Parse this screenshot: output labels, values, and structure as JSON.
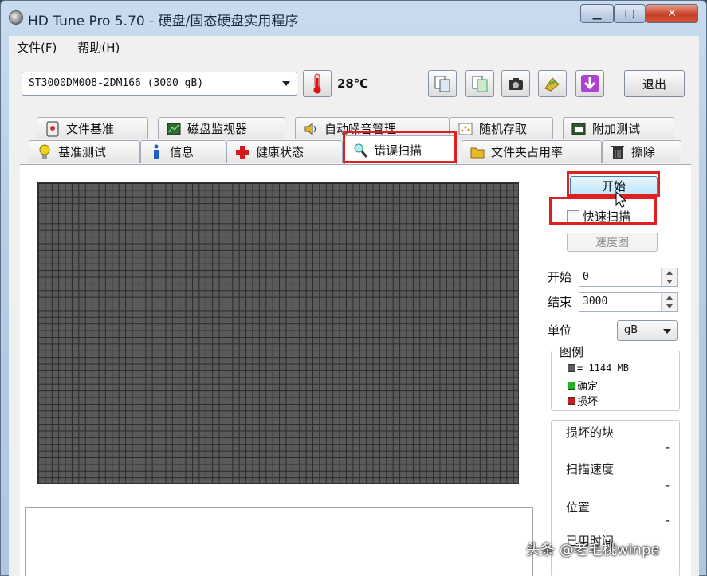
{
  "window": {
    "title": "HD Tune Pro 5.70 - 硬盘/固态硬盘实用程序"
  },
  "menu": {
    "file": "文件(F)",
    "help": "帮助(H)"
  },
  "toolbar": {
    "drive": "ST3000DM008-2DM166 (3000 gB)",
    "temperature": "28℃",
    "exit": "退出"
  },
  "tabs_row1": [
    {
      "label": "文件基准",
      "icon": "file-benchmark-icon"
    },
    {
      "label": "磁盘监视器",
      "icon": "disk-monitor-icon"
    },
    {
      "label": "自动噪音管理",
      "icon": "speaker-icon"
    },
    {
      "label": "随机存取",
      "icon": "random-access-icon"
    },
    {
      "label": "附加测试",
      "icon": "extra-tests-icon"
    }
  ],
  "tabs_row2": [
    {
      "label": "基准测试",
      "icon": "lightbulb-icon"
    },
    {
      "label": "信息",
      "icon": "info-icon"
    },
    {
      "label": "健康状态",
      "icon": "health-cross-icon"
    },
    {
      "label": "错误扫描",
      "icon": "magnifier-icon",
      "active": true
    },
    {
      "label": "文件夹占用率",
      "icon": "folder-icon"
    },
    {
      "label": "擦除",
      "icon": "trash-icon"
    }
  ],
  "scan": {
    "start_button": "开始",
    "quick_scan": "快速扫描",
    "speed_map": "速度图",
    "start_label": "开始",
    "start_value": "0",
    "end_label": "结束",
    "end_value": "3000",
    "unit_label": "单位",
    "unit_value": "gB"
  },
  "legend": {
    "caption": "图例",
    "block": "= 1144 MB",
    "ok": "确定",
    "damaged": "损坏",
    "colors": {
      "block": "#5a5a5a",
      "ok": "#22b322",
      "damaged": "#cc1a1a"
    }
  },
  "stats": {
    "damaged_blocks": "损坏的块",
    "damaged_blocks_val": "-",
    "scan_speed": "扫描速度",
    "scan_speed_val": "-",
    "position": "位置",
    "position_val": "-",
    "elapsed": "已用时间"
  },
  "watermark": "头条 @老毛桃winpe"
}
